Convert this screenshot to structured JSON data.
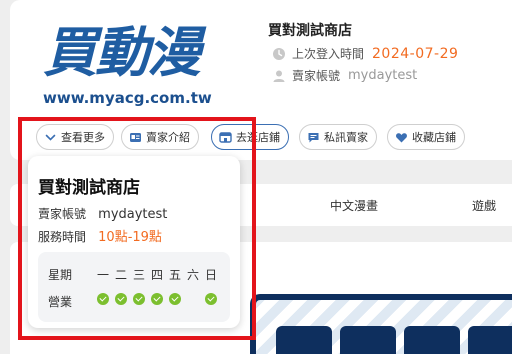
{
  "shop": {
    "logo_text": "買動漫",
    "logo_url": "www.myacg.com.tw",
    "name": "買對測試商店",
    "last_login_label": "上次登入時間",
    "last_login_date": "2024-07-29",
    "seller_account_label": "賣家帳號",
    "seller_account": "mydaytest"
  },
  "actions": [
    {
      "label": "查看更多",
      "icon": "chevron-down-icon"
    },
    {
      "label": "賣家介紹",
      "icon": "id-card-icon"
    },
    {
      "label": "去逛店鋪",
      "icon": "store-icon"
    },
    {
      "label": "私訊賣家",
      "icon": "chat-icon"
    },
    {
      "label": "收藏店鋪",
      "icon": "heart-icon"
    }
  ],
  "tabs": [
    "中文漫畫",
    "遊戲"
  ],
  "popup": {
    "title": "買對測試商店",
    "account_label": "賣家帳號",
    "account_value": "mydaytest",
    "hours_label": "服務時間",
    "hours_value": "10點-19點",
    "schedule": {
      "weekday_label": "星期",
      "business_label": "營業",
      "days": [
        "一",
        "二",
        "三",
        "四",
        "五",
        "六",
        "日"
      ],
      "open": [
        true,
        true,
        true,
        true,
        true,
        false,
        true
      ]
    }
  },
  "colors": {
    "accent_orange": "#f26b21",
    "brand_blue": "#1f5da2",
    "check_green": "#7cbf2f",
    "highlight_red": "#e3141b"
  }
}
